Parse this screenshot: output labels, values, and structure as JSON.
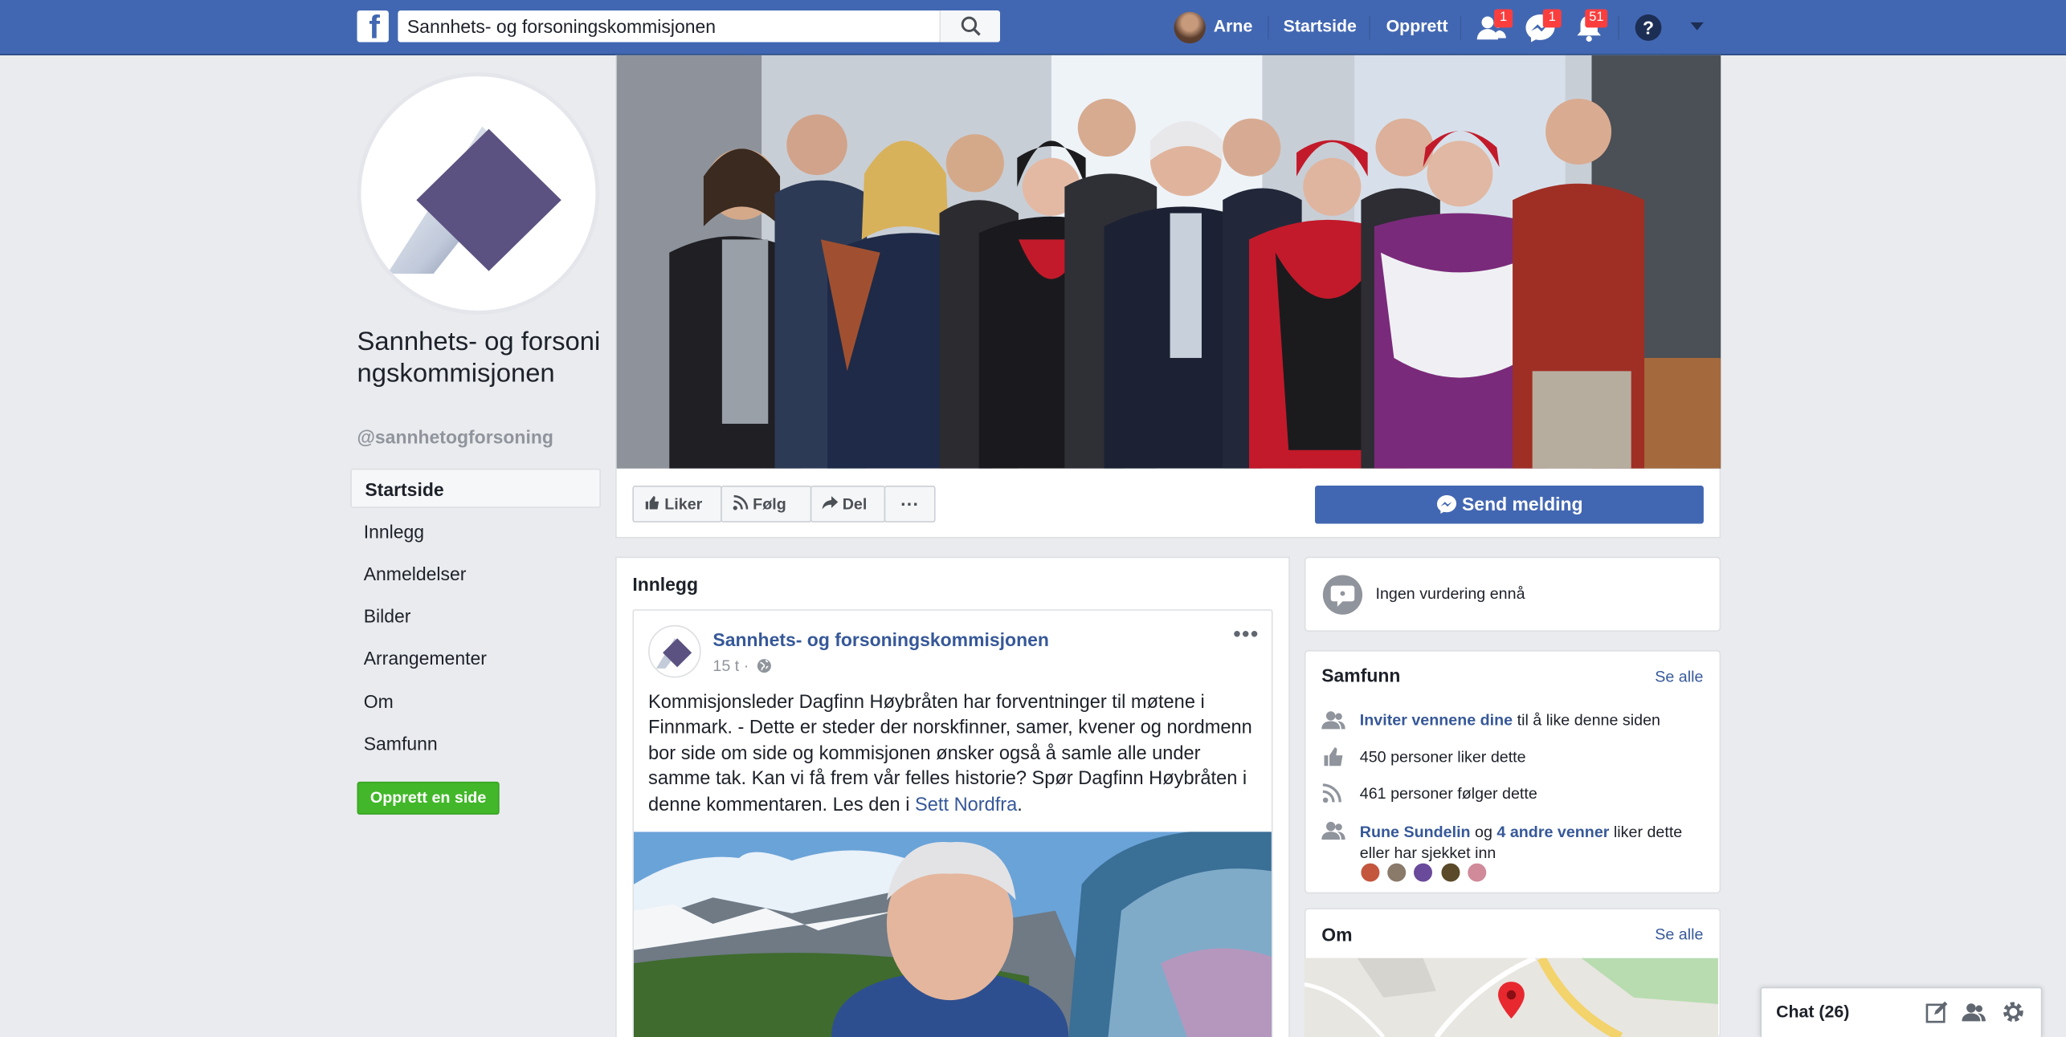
{
  "colors": {
    "brand": "#4267b2",
    "link": "#365899",
    "green": "#42b72a",
    "badge": "#fa3e3e"
  },
  "topbar": {
    "search_value": "Sannhets- og forsoningskommisjonen",
    "user_name": "Arne",
    "home": "Startside",
    "create": "Opprett",
    "friend_requests_badge": "1",
    "messages_badge": "1",
    "notifications_badge": "51",
    "icons": [
      "facebook-logo-icon",
      "search-icon",
      "friends-icon",
      "messenger-icon",
      "bell-icon",
      "help-icon",
      "caret-down-icon"
    ]
  },
  "page": {
    "name": "Sannhets- og forsoningskommisjonen",
    "handle": "@sannhetogforsoning"
  },
  "left_nav": {
    "items": [
      "Startside",
      "Innlegg",
      "Anmeldelser",
      "Bilder",
      "Arrangementer",
      "Om",
      "Samfunn"
    ],
    "create_page": "Opprett en side"
  },
  "actions": {
    "like": "Liker",
    "follow": "Følg",
    "share": "Del",
    "more": "···",
    "send_message": "Send melding"
  },
  "posts": {
    "section_title": "Innlegg",
    "post": {
      "author": "Sannhets- og forsoningskommisjonen",
      "time": "15 t ·",
      "menu": "•••",
      "text": "Kommisjonsleder Dagfinn Høybråten har forventninger til møtene i Finnmark. - Dette er steder der norskfinner, samer, kvener og nordmenn bor side om side og kommisjonen ønsker også å samle alle under samme tak. Kan vi få frem vår felles historie? Spør Dagfinn Høybråten i denne kommentaren. Les den i ",
      "link": "Sett Nordfra",
      "text_end": "."
    }
  },
  "right": {
    "rating": "Ingen vurdering ennå",
    "community": {
      "title": "Samfunn",
      "see_all": "Se alle",
      "invite_link": "Inviter vennene dine",
      "invite_rest": " til å like denne siden",
      "likes": "450 personer liker dette",
      "follows": "461 personer følger dette",
      "friend_name": "Rune Sundelin",
      "friend_mid": " og ",
      "friend_others": "4 andre venner",
      "friend_rest": " liker dette eller har sjekket inn"
    },
    "about": {
      "title": "Om",
      "see_all": "Se alle"
    }
  },
  "chat": {
    "label": "Chat (26)"
  }
}
